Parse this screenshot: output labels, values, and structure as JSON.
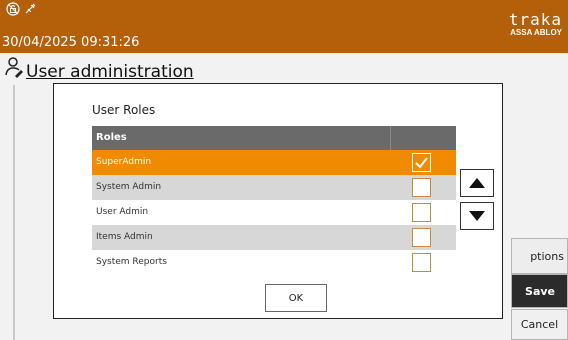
{
  "header": {
    "datetime": "30/04/2025 09:31:26",
    "logo_word": "traka",
    "logo_sub": "ASSA ABLOY",
    "status_icons": [
      "unlock-icon",
      "plug-icon"
    ],
    "color": "#b45f0a"
  },
  "page": {
    "title": "User administration",
    "title_icon": "user-edit-icon"
  },
  "side_buttons": {
    "options": "ptions",
    "save": "Save",
    "cancel": "Cancel"
  },
  "dialog": {
    "title": "User Roles",
    "table": {
      "header_roles": "Roles",
      "rows": [
        {
          "label": "SuperAdmin",
          "checked": true,
          "selected": true
        },
        {
          "label": "System Admin",
          "checked": false,
          "selected": false
        },
        {
          "label": "User Admin",
          "checked": false,
          "selected": false
        },
        {
          "label": "Items Admin",
          "checked": false,
          "selected": false
        },
        {
          "label": "System Reports",
          "checked": false,
          "selected": false
        }
      ]
    },
    "move_up_icon": "triangle-up-icon",
    "move_down_icon": "triangle-down-icon",
    "ok_label": "OK",
    "accent": "#f08a00"
  }
}
